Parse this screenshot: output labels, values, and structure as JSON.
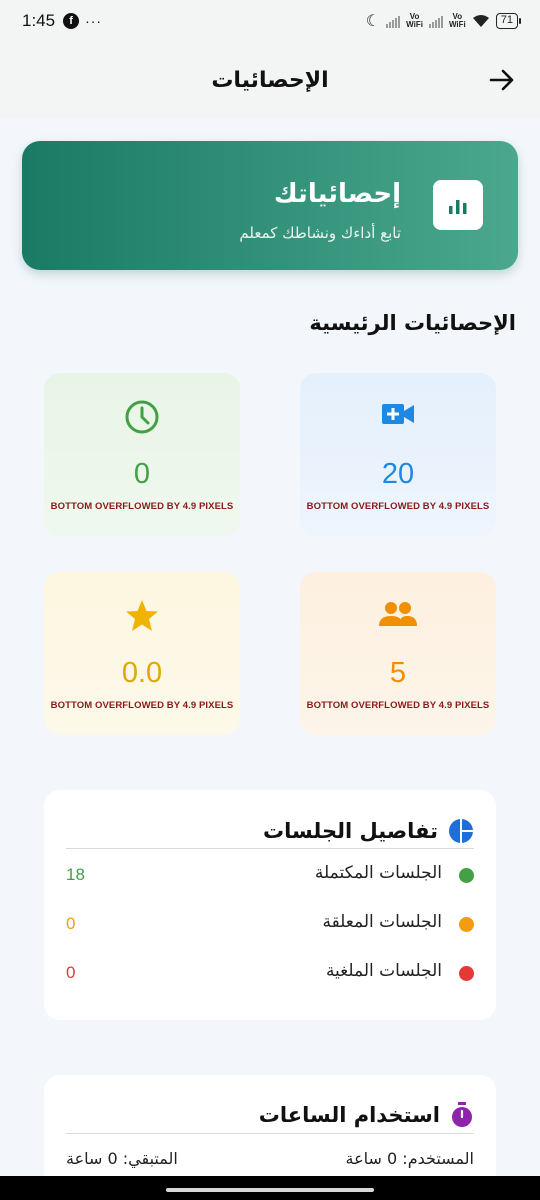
{
  "status_bar": {
    "time": "1:45",
    "fb_glyph": "f",
    "dots": "···",
    "vowifi_1": "Vo\nWiFi",
    "vowifi_2": "Vo\nWiFi",
    "battery": "71"
  },
  "app_bar": {
    "title": "الإحصائيات"
  },
  "header": {
    "title": "إحصائياتك",
    "subtitle": "تابع أداءك ونشاطك كمعلم"
  },
  "section_title": "الإحصائيات الرئيسية",
  "stats": [
    {
      "icon": "video-add-icon",
      "value": "20",
      "overflow": "BOTTOM OVERFLOWED BY 4.9 PIXELS",
      "color": "#1e88e5"
    },
    {
      "icon": "clock-icon",
      "value": "0",
      "overflow": "BOTTOM OVERFLOWED BY 4.9 PIXELS",
      "color": "#43a047"
    },
    {
      "icon": "people-icon",
      "value": "5",
      "overflow": "BOTTOM OVERFLOWED BY 4.9 PIXELS",
      "color": "#f09000"
    },
    {
      "icon": "star-icon",
      "value": "0.0",
      "overflow": "BOTTOM OVERFLOWED BY 4.9 PIXELS",
      "color": "#e0a800"
    }
  ],
  "sessions": {
    "title": "تفاصيل الجلسات",
    "rows": [
      {
        "label": "الجلسات المكتملة",
        "value": "18",
        "color": "#43a047"
      },
      {
        "label": "الجلسات المعلقة",
        "value": "0",
        "color": "#f39c12"
      },
      {
        "label": "الجلسات الملغية",
        "value": "0",
        "color": "#e53935"
      }
    ]
  },
  "hours": {
    "title": "استخدام الساعات",
    "used": "المستخدم: 0 ساعة",
    "remaining": "المتبقي: 0 ساعة"
  }
}
